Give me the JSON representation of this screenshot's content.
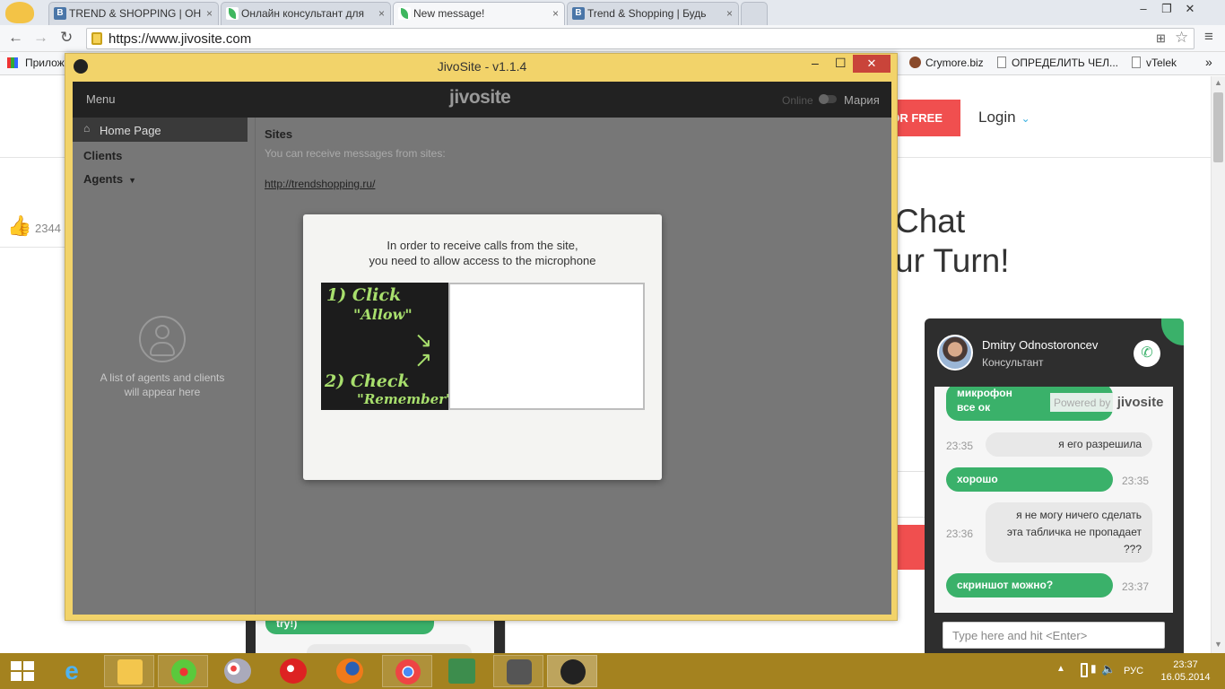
{
  "browser": {
    "tabs": [
      {
        "label": "TREND & SHOPPING | ОН",
        "icon": "vk"
      },
      {
        "label": "Онлайн консультант для",
        "icon": "leaf"
      },
      {
        "label": "New message!",
        "icon": "leaf"
      },
      {
        "label": "Trend & Shopping | Будь",
        "icon": "vk"
      }
    ],
    "url": "https://www.jivosite.com",
    "bookmarks": {
      "apps": "Прилож",
      "b1": "Crymore.biz",
      "b2": "ОПРЕДЕЛИТЬ ЧЕЛ...",
      "b3": "vTelek",
      "more": "»"
    }
  },
  "site": {
    "cta": "OR FREE",
    "login": "Login",
    "likes": "2344",
    "headline_line1": "Chat",
    "headline_line2": "ur Turn!",
    "snippet": "try!)"
  },
  "app": {
    "title": "JivoSite - v1.1.4",
    "menu": "Menu",
    "logo": "jivosite",
    "status": "Online",
    "user": "Мария",
    "nav": {
      "home": "Home Page",
      "clients": "Clients",
      "agents": "Agents"
    },
    "empty_hint_line1": "A list of agents and clients",
    "empty_hint_line2": "will appear here",
    "sites_title": "Sites",
    "sites_desc": "You can receive messages from sites:",
    "site_link": "http://trendshopping.ru/",
    "modal": {
      "line1": "In order to receive calls from the site,",
      "line2": "you need to allow access to the microphone",
      "hint1": "1) Click",
      "hint1b": "\"Allow\"",
      "hint2": "2) Check",
      "hint2b": "\"Remember\""
    }
  },
  "chat": {
    "agent_name": "Dmitry Odnostoroncev",
    "agent_role": "Консультант",
    "powered": "Powered by",
    "powered_logo": "jivosite",
    "clip1": "микрофон",
    "clip2": "все ок",
    "messages": [
      {
        "side": "left",
        "time": "23:35",
        "text": "я его разрешила"
      },
      {
        "side": "right",
        "time": "23:35",
        "text": "хорошо"
      },
      {
        "side": "left",
        "time": "23:36",
        "l1": "я не могу ничего сделать",
        "l2": "эта табличка не пропадает",
        "l3": "???"
      },
      {
        "side": "right",
        "time": "23:37",
        "text": "скриншот можно?"
      }
    ],
    "input_placeholder": "Type here and hit <Enter>"
  },
  "taskbar": {
    "lang": "РУС",
    "time": "23:37",
    "date": "16.05.2014"
  },
  "colors": {
    "jivo_green": "#3ab16a",
    "window_frame": "#f2d36a",
    "taskbar": "#a4821f",
    "cta_red": "#f04f4f"
  }
}
